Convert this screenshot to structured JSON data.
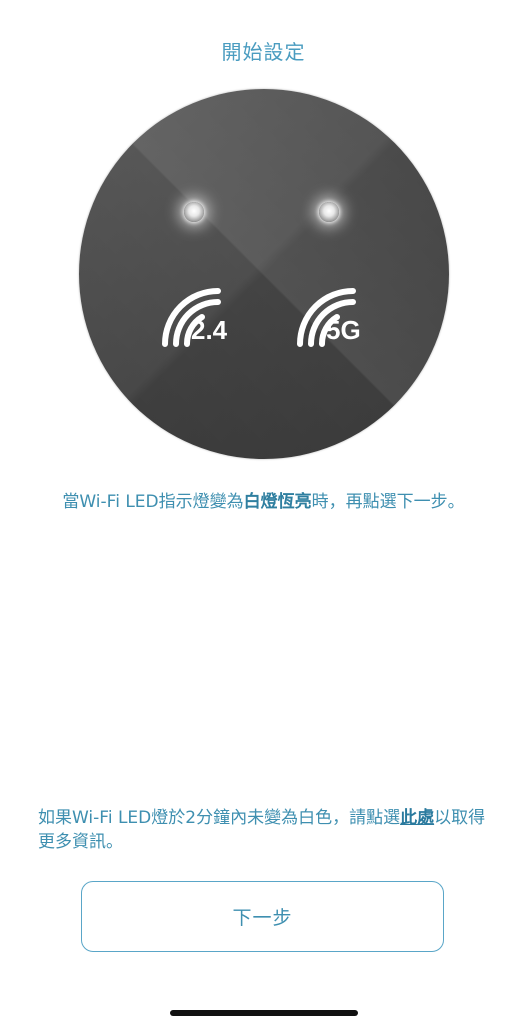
{
  "header": {
    "title": "開始設定"
  },
  "device": {
    "band_left_label": "2.4",
    "band_right_label": "5G",
    "led_left_icon": "led-light-icon",
    "led_right_icon": "led-light-icon",
    "wifi_icon": "wifi-signal-icon"
  },
  "instruction": {
    "prefix": "當Wi-Fi LED指示燈變為",
    "highlight": "白燈恆亮",
    "suffix": "時，再點選下一步。"
  },
  "help": {
    "prefix": "如果Wi-Fi LED燈於2分鐘內未變為白色，請點選",
    "link": "此處",
    "suffix": "以取得更多資訊。"
  },
  "buttons": {
    "next_label": "下一步"
  },
  "colors": {
    "accent": "#3e8fb0",
    "device": "#4e4e4e"
  }
}
